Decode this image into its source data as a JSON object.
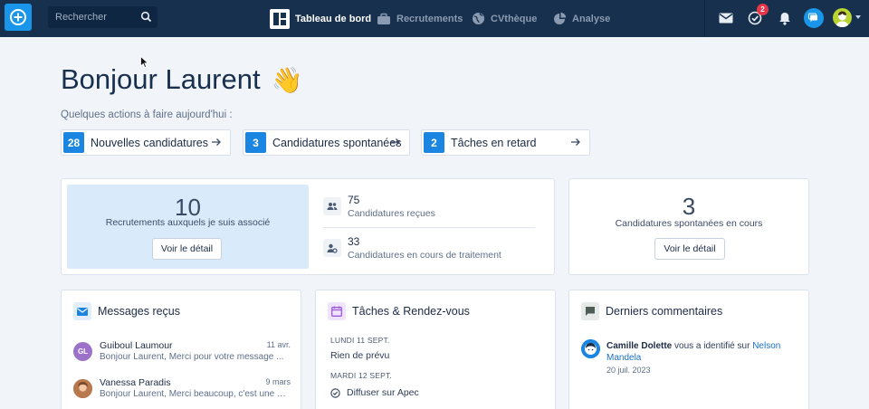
{
  "nav": {
    "search_placeholder": "Rechercher",
    "items": [
      {
        "label": "Tableau de bord",
        "active": true
      },
      {
        "label": "Recrutements",
        "active": false
      },
      {
        "label": "CVthèque",
        "active": false
      },
      {
        "label": "Analyse",
        "active": false
      }
    ],
    "tasks_badge": "2"
  },
  "greeting": {
    "title": "Bonjour Laurent",
    "emoji": "👋"
  },
  "actions": {
    "subtitle": "Quelques actions à faire aujourd'hui :",
    "items": [
      {
        "count": "28",
        "label": "Nouvelles candidatures"
      },
      {
        "count": "3",
        "label": "Candidatures spontanées"
      },
      {
        "count": "2",
        "label": "Tâches en retard"
      }
    ]
  },
  "recruitments": {
    "count": "10",
    "label": "Recrutements auxquels je suis associé",
    "button": "Voir le détail",
    "stats": [
      {
        "value": "75",
        "label": "Candidatures reçues"
      },
      {
        "value": "33",
        "label": "Candidatures en cours de traitement"
      }
    ]
  },
  "spontaneous": {
    "count": "3",
    "label": "Candidatures spontanées en cours",
    "button": "Voir le détail"
  },
  "messages": {
    "title": "Messages reçus",
    "items": [
      {
        "initials": "GL",
        "name": "Guiboul Laumour",
        "date": "11 avr.",
        "text": "Bonjour Laurent, Merci pour votre message ..."
      },
      {
        "initials": "",
        "name": "Vanessa Paradis",
        "date": "9 mars",
        "text": "Bonjour Laurent, Merci beaucoup, c'est une s..."
      }
    ]
  },
  "tasks": {
    "title": "Tâches & Rendez-vous",
    "days": [
      {
        "day": "LUNDI 11 SEPT.",
        "task": "Rien de prévu"
      },
      {
        "day": "MARDI 12 SEPT.",
        "task": "Diffuser sur Apec"
      }
    ]
  },
  "comments": {
    "title": "Derniers commentaires",
    "item": {
      "author": "Camille Dolette",
      "text": "vous a identifié sur",
      "link": "Nelson Mandela",
      "date": "20 juil. 2023"
    }
  },
  "colors": {
    "navbar": "#17304d",
    "accent": "#1a86e1",
    "highlight": "#d9eafb",
    "badge": "#e5364a"
  },
  "icons": [
    "plus-circle-icon",
    "search-icon",
    "dashboard-icon",
    "briefcase-icon",
    "globe-icon",
    "analytics-icon",
    "mail-icon",
    "check-icon",
    "bell-icon",
    "chat-icon",
    "avatar",
    "arrow-right-icon",
    "people-icon",
    "person-gear-icon",
    "mail-icon",
    "calendar-icon",
    "comment-icon",
    "check-circle-icon"
  ]
}
